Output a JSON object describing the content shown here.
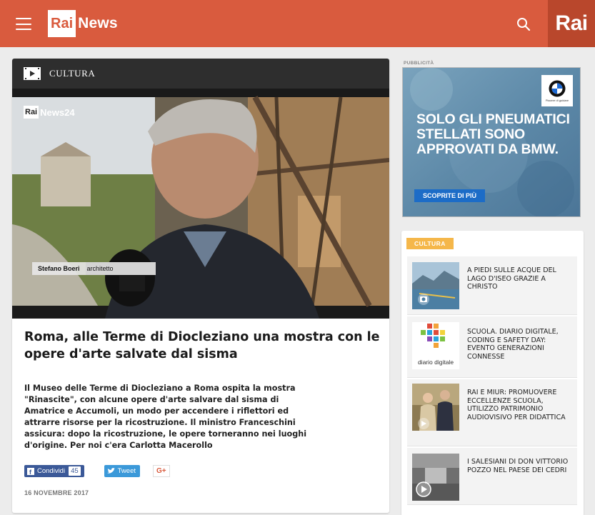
{
  "header": {
    "logo_box": "Rai",
    "logo_text": "News",
    "corner_logo": "Rai",
    "menu_icon": "hamburger-menu-icon",
    "search_icon": "search-icon",
    "brand_color": "#d95b3e"
  },
  "article": {
    "section": "CULTURA",
    "section_icon": "video-play-icon",
    "video": {
      "channel_box": "Rai",
      "channel_text": "News24",
      "lower_third_name": "Stefano Boeri",
      "lower_third_role": "architetto"
    },
    "title": "Roma, alle Terme di Diocleziano una mostra con le opere d'arte salvate dal sisma",
    "description": "Il Museo delle Terme di Diocleziano a Roma ospita la mostra \"Rinascite\", con alcune opere d'arte salvare dal sisma di Amatrice e Accumoli, un modo per accendere i riflettori ed attrarre risorse per la ricostruzione. Il ministro Franceschini assicura: dopo la ricostruzione, le opere torneranno nei luoghi d'origine. Per noi c'era Carlotta Macerollo",
    "share": {
      "facebook_label": "Condividi",
      "facebook_count": "45",
      "twitter_label": "Tweet",
      "gplus_label": "G+"
    },
    "date": "16 NOVEMBRE 2017"
  },
  "ad": {
    "label": "PUBBLICITÀ",
    "brand_sub": "Piacere di guidare",
    "headline": "SOLO GLI PNEUMATICI STELLATI SONO APPROVATI DA BMW.",
    "cta": "SCOPRITE DI PIÙ"
  },
  "sidebar": {
    "tag": "CULTURA",
    "items": [
      {
        "title": "A piedi sulle acque del lago d'Iseo grazie a Christo",
        "thumb": "lake-photo"
      },
      {
        "title": "Scuola. Diario digitale, coding e safety day: evento Generazioni Connesse",
        "thumb": "diario-digitale-logo",
        "thumb_caption": "diario digitale"
      },
      {
        "title": "Rai e Miur: promuovere eccellenze scuola, utilizzo patrimonio audiovisivo per didattica",
        "thumb": "people-photo"
      },
      {
        "title": "I salesiani di Don Vittorio Pozzo nel paese dei cedri",
        "thumb": "archive-video-photo"
      }
    ]
  }
}
